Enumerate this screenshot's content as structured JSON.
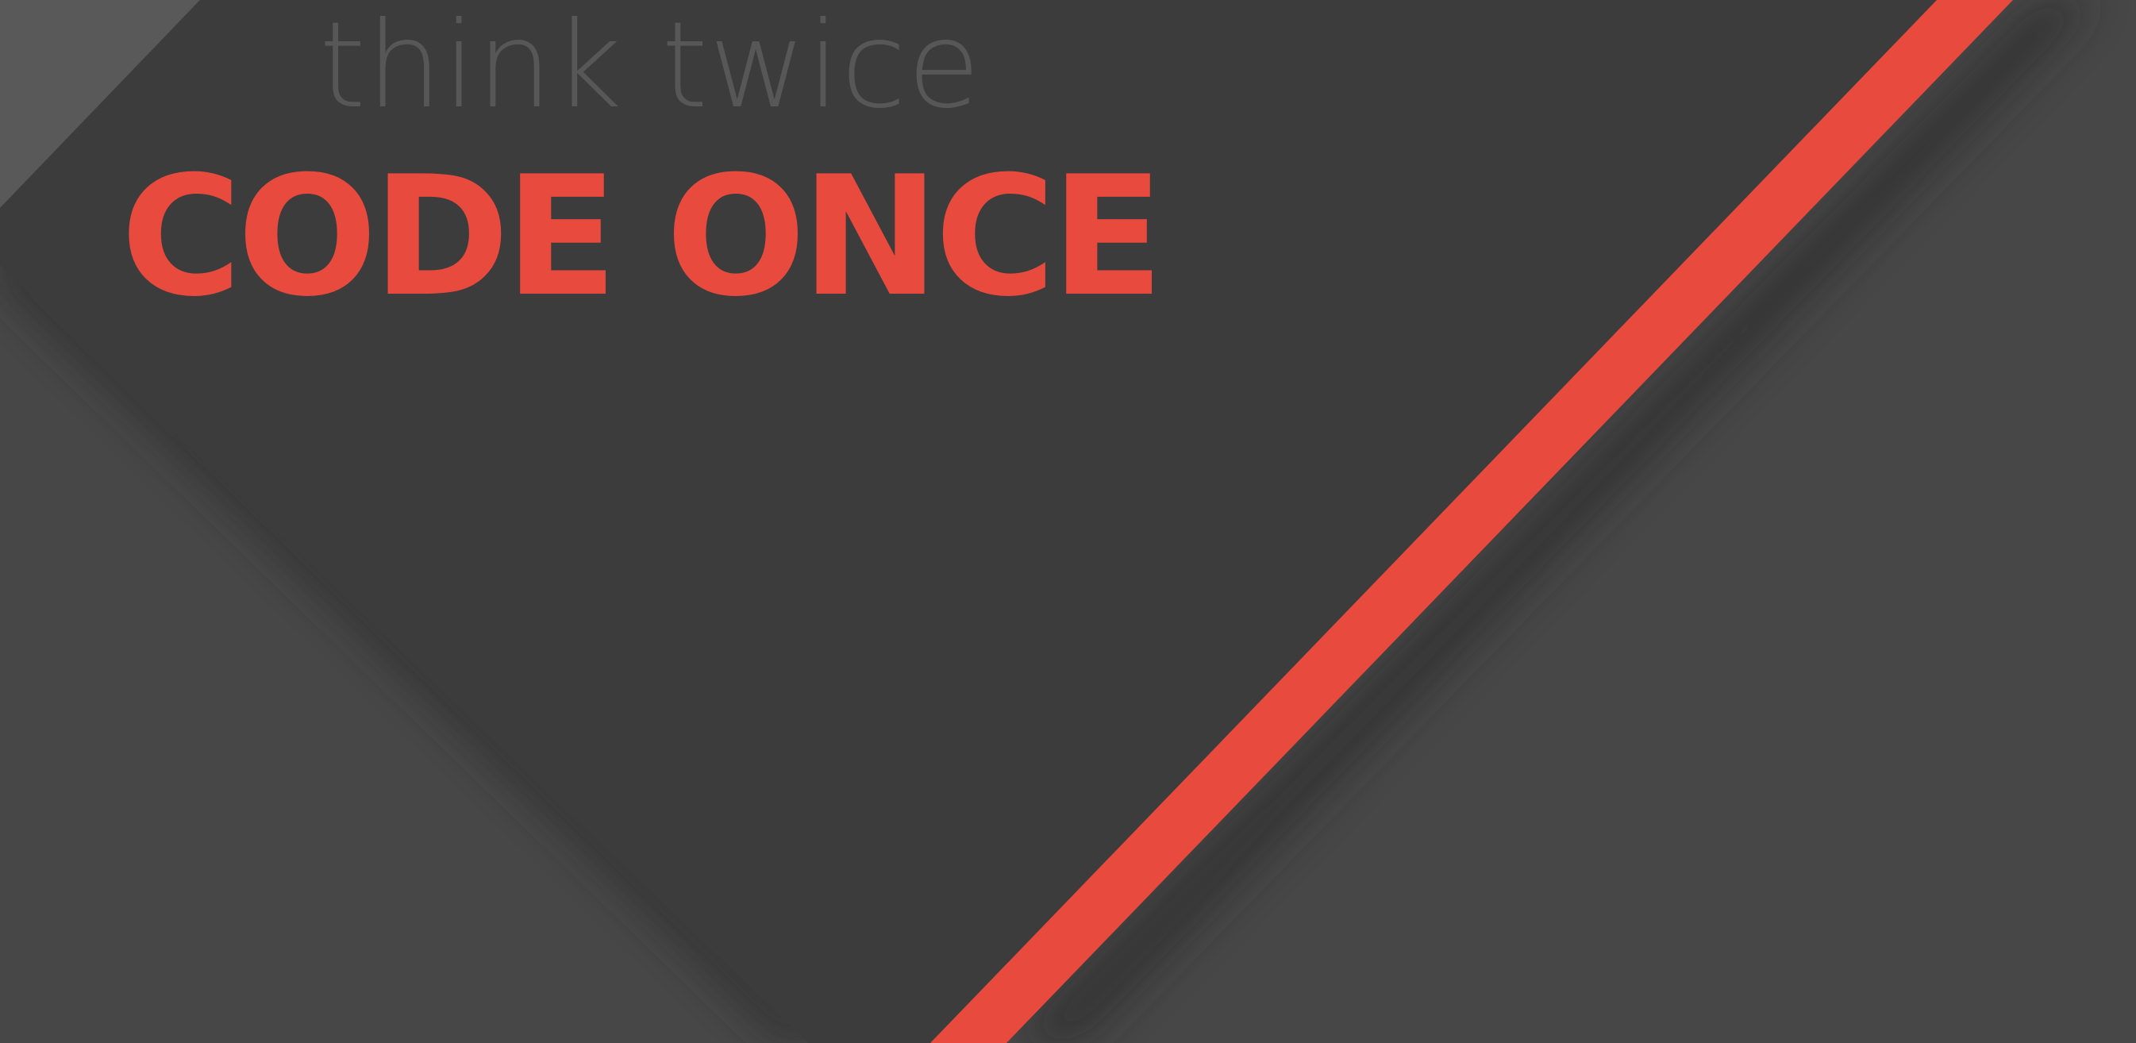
{
  "wallpaper": {
    "tagline": "think twice",
    "headline": "CODE ONCE",
    "colors": {
      "accent": "#e84a3d",
      "dark_panel": "#3c3c3c",
      "background": "#474747",
      "corner": "#595959",
      "tagline_text": "#575757"
    }
  }
}
